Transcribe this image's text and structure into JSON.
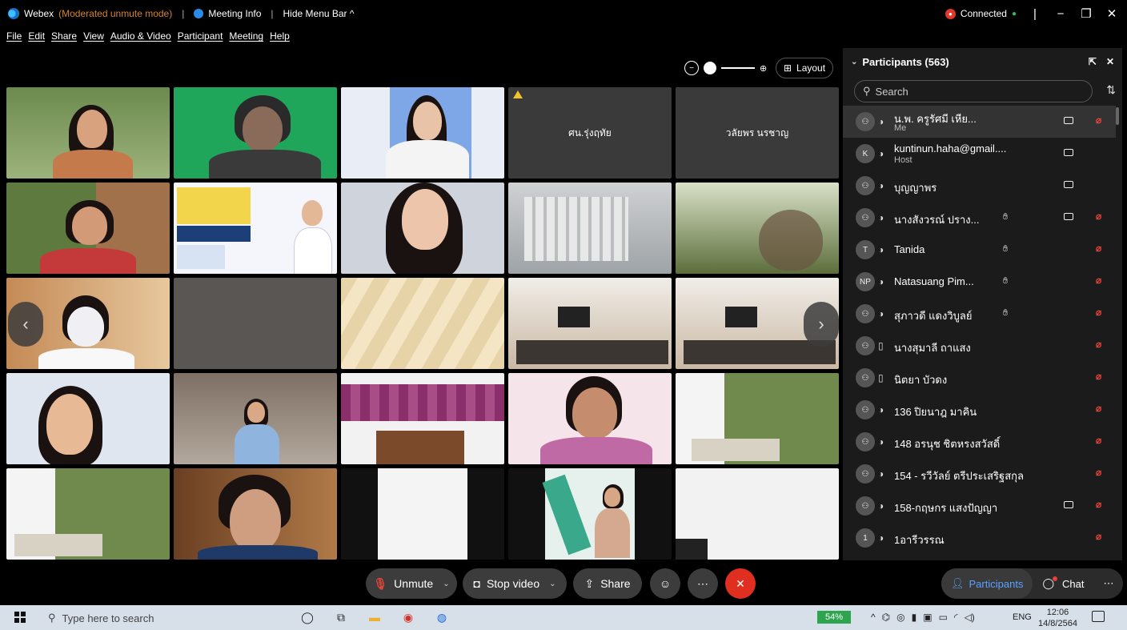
{
  "titlebar": {
    "app_name": "Webex",
    "mode": "(Moderated unmute mode)",
    "meeting_info": "Meeting Info",
    "hide_menu": "Hide Menu Bar ^",
    "connected": "Connected"
  },
  "menu": [
    "File",
    "Edit",
    "Share",
    "View",
    "Audio & Video",
    "Participant",
    "Meeting",
    "Help"
  ],
  "layout_label": "Layout",
  "tiles": {
    "r1c4": "ศน.รุ่งฤทัย",
    "r1c5": "วลัยพร นรชาญ"
  },
  "participants": {
    "title": "Participants (563)",
    "search_placeholder": "Search",
    "rows": [
      {
        "avatar": "",
        "name": "น.พ. ครูรัศมี เหีย...",
        "role": "Me",
        "hand": false,
        "cam": true,
        "muted": true,
        "me": true
      },
      {
        "avatar": "K",
        "name": "kuntinun.haha@gmail....",
        "role": "Host",
        "hand": false,
        "cam": true,
        "muted": false
      },
      {
        "avatar": "",
        "name": "บุญญาพร",
        "role": "",
        "hand": false,
        "cam": true,
        "muted": false
      },
      {
        "avatar": "",
        "name": "นางสังวรณ์ ปราง...",
        "role": "",
        "hand": true,
        "cam": true,
        "muted": true
      },
      {
        "avatar": "T",
        "name": "Tanida",
        "role": "",
        "hand": true,
        "cam": false,
        "muted": true
      },
      {
        "avatar": "NP",
        "name": "Natasuang Pim...",
        "role": "",
        "hand": true,
        "cam": false,
        "muted": true
      },
      {
        "avatar": "",
        "name": "สุภาวดี แดงวิบูลย์",
        "role": "",
        "hand": true,
        "cam": false,
        "muted": true
      },
      {
        "avatar": "",
        "name": "นางสุมาลี ถาแสง",
        "role": "",
        "hand": false,
        "cam": false,
        "muted": true
      },
      {
        "avatar": "",
        "name": "นิตยา บัวดง",
        "role": "",
        "hand": false,
        "cam": false,
        "muted": true
      },
      {
        "avatar": "",
        "name": "136 ปิยนาฎ มาคิน",
        "role": "",
        "hand": false,
        "cam": false,
        "muted": true
      },
      {
        "avatar": "",
        "name": "148 อรนุช ชิตหรงสวัสดิ์",
        "role": "",
        "hand": false,
        "cam": false,
        "muted": true
      },
      {
        "avatar": "",
        "name": "154 - รวีวัลย์ ตรีประเสริฐสกุล",
        "role": "",
        "hand": false,
        "cam": false,
        "muted": true
      },
      {
        "avatar": "",
        "name": "158-กฤษกร แสงปัญญา",
        "role": "",
        "hand": false,
        "cam": true,
        "muted": true
      },
      {
        "avatar": "1",
        "name": "1อารีวรรณ",
        "role": "",
        "hand": false,
        "cam": false,
        "muted": true
      }
    ]
  },
  "controls": {
    "unmute": "Unmute",
    "stop_video": "Stop video",
    "share": "Share",
    "participants_tab": "Participants",
    "chat_tab": "Chat"
  },
  "taskbar": {
    "search_placeholder": "Type here to search",
    "battery": "54%",
    "lang": "ENG",
    "time": "12:06",
    "date": "14/8/2564"
  }
}
